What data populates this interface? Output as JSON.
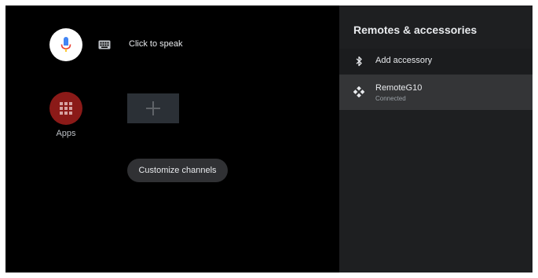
{
  "home": {
    "voice": {
      "icon": "mic-icon",
      "keyboard_icon": "keyboard-icon",
      "label": "Click to speak"
    },
    "apps": {
      "icon": "apps-grid-icon",
      "label": "Apps"
    },
    "add_tile": {
      "icon": "plus-icon"
    },
    "customize_label": "Customize channels"
  },
  "panel": {
    "title": "Remotes & accessories",
    "items": [
      {
        "icon": "bluetooth-icon",
        "label": "Add accessory"
      },
      {
        "icon": "gamepad-icon",
        "label": "RemoteG10",
        "sublabel": "Connected"
      }
    ]
  },
  "colors": {
    "screen_bg": "#000000",
    "panel_bg": "#1e1f21",
    "selected_item_bg": "#343537",
    "apps_red": "#8b1a18",
    "mic_blue": "#4285f4",
    "mic_red": "#ea4335"
  }
}
